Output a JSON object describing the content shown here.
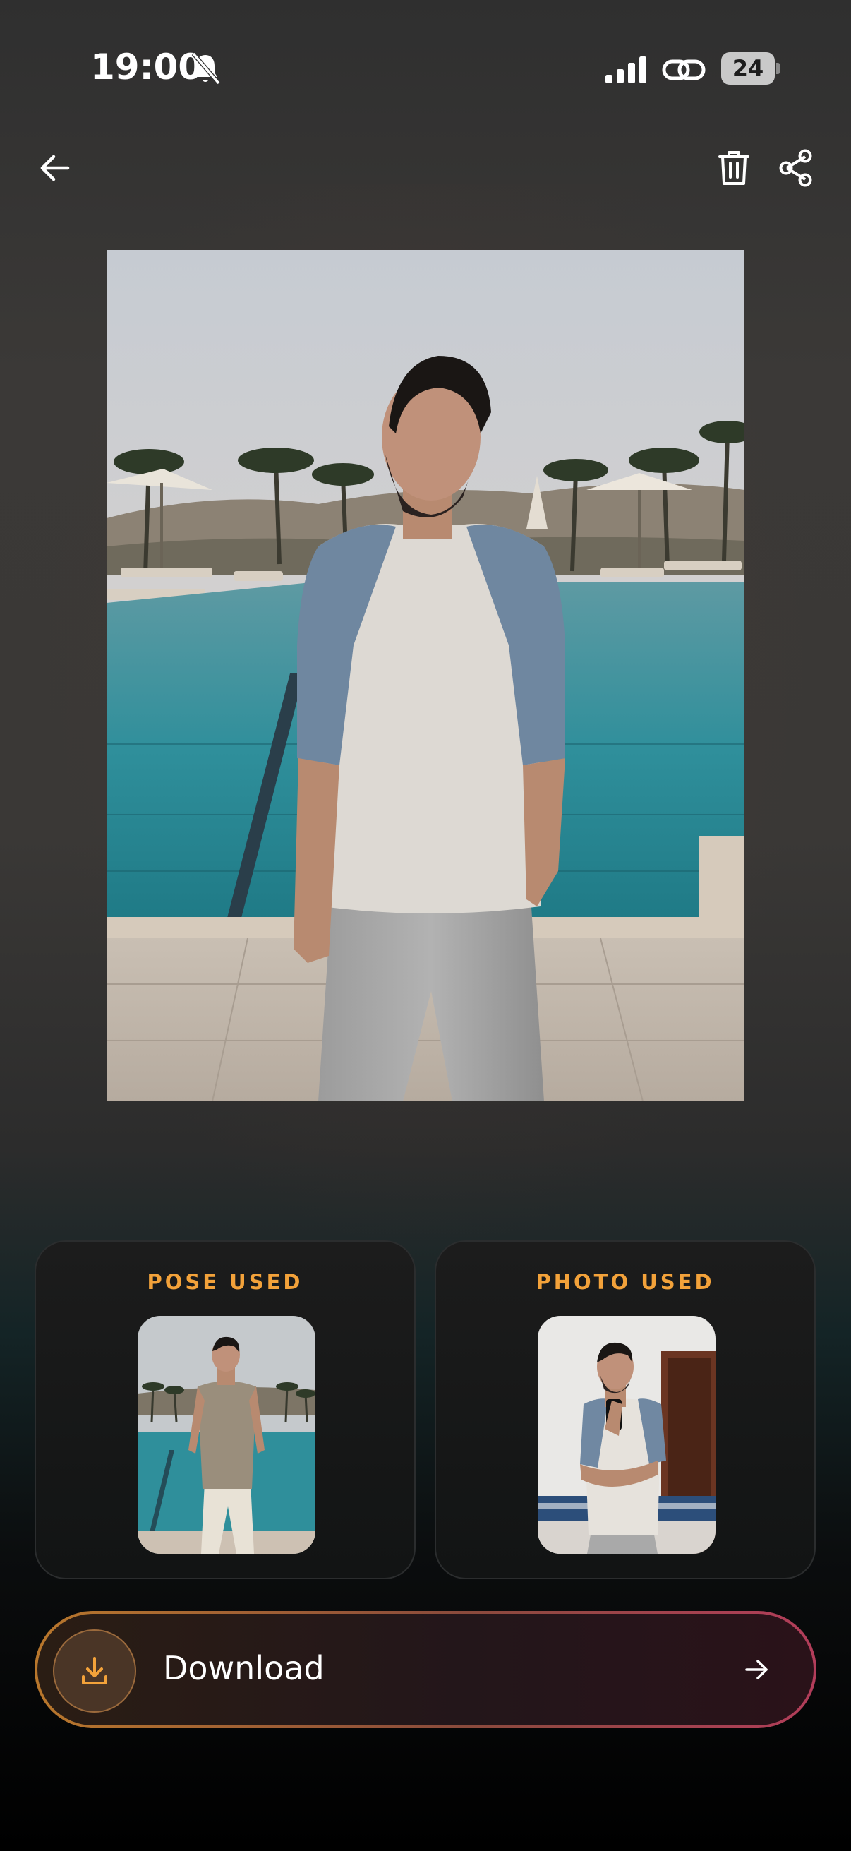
{
  "status_bar": {
    "time": "19:00",
    "battery_level": "24",
    "icons": [
      "bell-muted-icon",
      "cellular-signal-icon",
      "link-icon",
      "battery-icon"
    ]
  },
  "toolbar": {
    "icons": [
      "back-arrow-icon",
      "trash-icon",
      "share-icon"
    ]
  },
  "cards": {
    "pose": {
      "title": "POSE USED"
    },
    "photo": {
      "title": "PHOTO USED"
    }
  },
  "download": {
    "label": "Download",
    "icons": [
      "download-icon",
      "arrow-right-icon"
    ]
  },
  "colors": {
    "accent": "#f3a23a",
    "gradient_start": "#b8772c",
    "gradient_end": "#b23d5a"
  }
}
